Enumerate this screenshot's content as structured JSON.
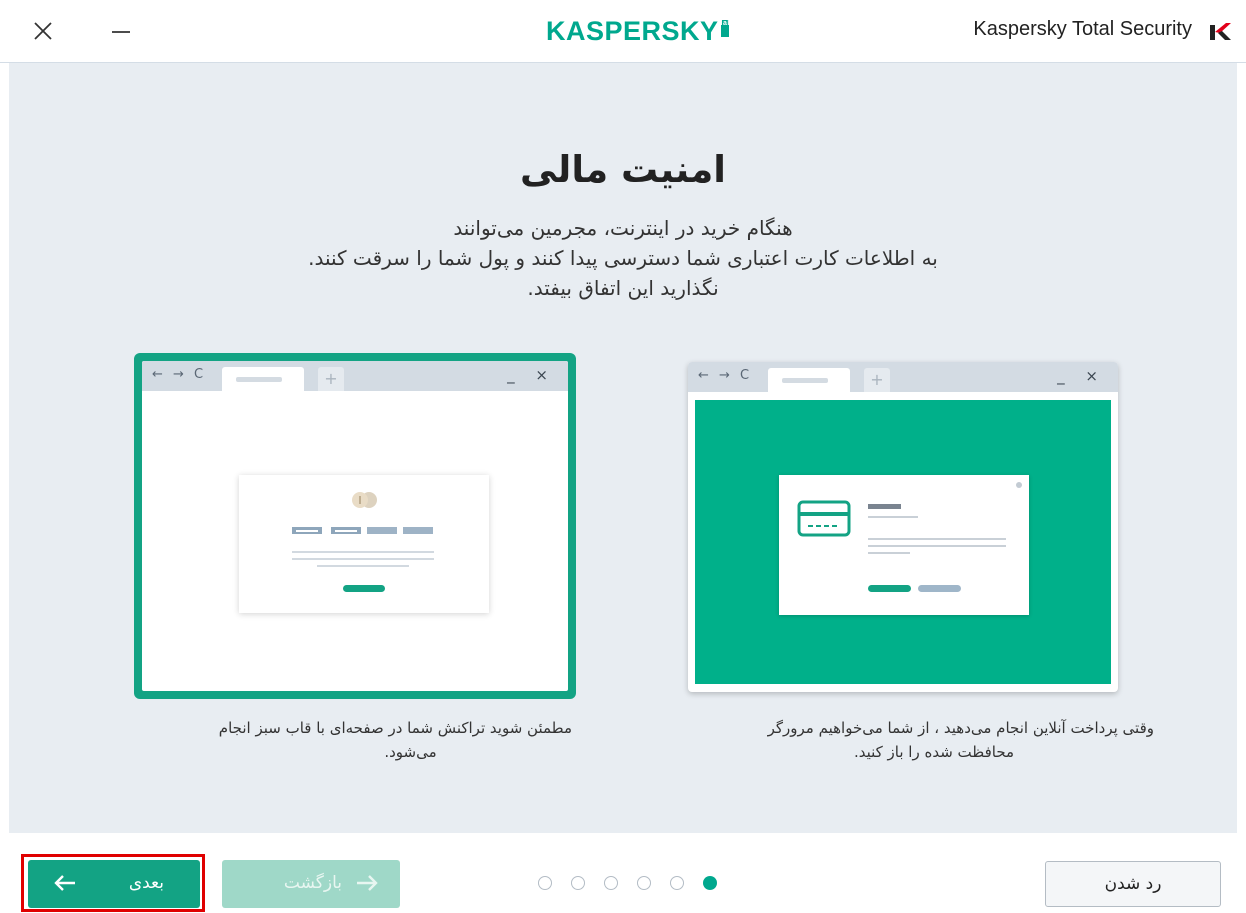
{
  "titlebar": {
    "close_icon": "close-icon",
    "minimize_icon": "minimize-icon",
    "brand": "KASPERSKY",
    "brand_badge": "lab",
    "app_name": "Kaspersky Total Security"
  },
  "main": {
    "title": "امنیت مالی",
    "description_lines": [
      "هنگام خرید در اینترنت، مجرمین می‌توانند",
      "به اطلاعات کارت اعتباری شما دسترسی پیدا کنند و پول شما را سرقت کنند.",
      "نگذارید این اتفاق بیفتد."
    ],
    "illustrations": [
      {
        "caption": "مطمئن شوید تراکنش شما در صفحه‌ای با قاب سبز انجام می‌شود.",
        "caption_line1": "مطمئن شوید تراکنش شما در صفحه‌ای با قاب سبز انجام",
        "caption_line2": "می‌شود."
      },
      {
        "caption": "وقتی پرداخت آنلاین انجام می‌دهید ، از شما می‌خواهیم مرورگر محافظت شده را باز کنید.",
        "caption_line1": "وقتی پرداخت آنلاین انجام می‌دهید ، از شما می‌خواهیم مرورگر",
        "caption_line2": "محافظت شده را باز کنید."
      }
    ],
    "browser_nav": "← → C",
    "browser_controls": "_ ×",
    "new_tab": "+"
  },
  "footer": {
    "next_label": "بعدی",
    "back_label": "بازگشت",
    "decline_label": "رد شدن",
    "pager": {
      "total": 6,
      "active": 6
    }
  },
  "colors": {
    "accent": "#00a88e",
    "background": "#e8edf2",
    "highlight": "#e00000"
  }
}
